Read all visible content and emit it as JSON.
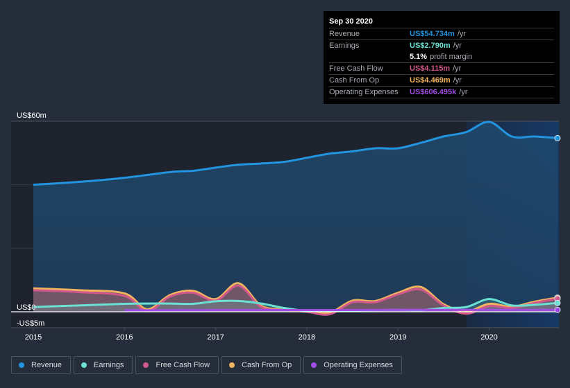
{
  "tooltip": {
    "date": "Sep 30 2020",
    "rows": [
      {
        "label": "Revenue",
        "value": "US$54.734m",
        "unit": "/yr",
        "color": "#2394df"
      },
      {
        "label": "Earnings",
        "value": "US$2.790m",
        "unit": "/yr",
        "color": "#6ce0d3"
      },
      {
        "label": "",
        "margin_pct": "5.1%",
        "margin_text": "profit margin"
      },
      {
        "label": "Free Cash Flow",
        "value": "US$4.115m",
        "unit": "/yr",
        "color": "#d1588b"
      },
      {
        "label": "Cash From Op",
        "value": "US$4.469m",
        "unit": "/yr",
        "color": "#f2b35e"
      },
      {
        "label": "Operating Expenses",
        "value": "US$606.495k",
        "unit": "/yr",
        "color": "#a24de8"
      }
    ]
  },
  "legend": [
    {
      "label": "Revenue",
      "color": "#2394df"
    },
    {
      "label": "Earnings",
      "color": "#6ce0d3"
    },
    {
      "label": "Free Cash Flow",
      "color": "#d1588b"
    },
    {
      "label": "Cash From Op",
      "color": "#f2b35e"
    },
    {
      "label": "Operating Expenses",
      "color": "#a24de8"
    }
  ],
  "chart_data": {
    "type": "area",
    "title": "",
    "xlabel": "",
    "ylabel": "",
    "xlim": [
      2015.0,
      2020.75
    ],
    "ylim": [
      -5,
      60
    ],
    "y_ticks": [
      {
        "value": 60,
        "label": "US$60m"
      },
      {
        "value": 0,
        "label": "US$0"
      },
      {
        "value": -5,
        "label": "-US$5m"
      }
    ],
    "x_ticks": [
      {
        "value": 2015,
        "label": "2015"
      },
      {
        "value": 2016,
        "label": "2016"
      },
      {
        "value": 2017,
        "label": "2017"
      },
      {
        "value": 2018,
        "label": "2018"
      },
      {
        "value": 2019,
        "label": "2019"
      },
      {
        "value": 2020,
        "label": "2020"
      }
    ],
    "highlight_from": 2019.75,
    "grid": true,
    "legend_position": "bottom-left",
    "series": [
      {
        "name": "Revenue",
        "color": "#2394df",
        "x": [
          2015.0,
          2015.5,
          2016.0,
          2016.5,
          2016.75,
          2017.0,
          2017.25,
          2017.5,
          2017.75,
          2018.0,
          2018.25,
          2018.5,
          2018.75,
          2019.0,
          2019.25,
          2019.5,
          2019.75,
          2020.0,
          2020.25,
          2020.5,
          2020.75
        ],
        "values": [
          40.0,
          40.9,
          42.2,
          44.0,
          44.4,
          45.4,
          46.3,
          46.7,
          47.2,
          48.5,
          49.8,
          50.5,
          51.5,
          51.5,
          53.2,
          55.2,
          56.6,
          59.8,
          55.2,
          55.2,
          54.7
        ]
      },
      {
        "name": "Earnings",
        "color": "#6ce0d3",
        "x": [
          2015.0,
          2015.5,
          2016.0,
          2016.25,
          2016.5,
          2016.75,
          2017.0,
          2017.25,
          2017.5,
          2017.75,
          2018.0,
          2018.25,
          2018.5,
          2018.75,
          2019.0,
          2019.25,
          2019.5,
          2019.75,
          2020.0,
          2020.25,
          2020.5,
          2020.75
        ],
        "values": [
          1.5,
          2.0,
          2.5,
          2.6,
          2.6,
          2.5,
          3.3,
          3.4,
          2.6,
          1.2,
          0.3,
          0.3,
          0.4,
          0.5,
          0.6,
          0.5,
          1.2,
          1.5,
          4.0,
          2.0,
          2.2,
          2.79
        ]
      },
      {
        "name": "Free Cash Flow",
        "color": "#d1588b",
        "x": [
          2015.0,
          2015.5,
          2016.0,
          2016.25,
          2016.5,
          2016.75,
          2017.0,
          2017.25,
          2017.5,
          2017.75,
          2018.0,
          2018.25,
          2018.5,
          2018.75,
          2019.0,
          2019.25,
          2019.5,
          2019.75,
          2020.0,
          2020.25,
          2020.5,
          2020.75
        ],
        "values": [
          6.8,
          6.2,
          5.0,
          0.2,
          4.8,
          6.0,
          3.5,
          8.2,
          1.5,
          0.6,
          0.0,
          -0.8,
          3.0,
          3.0,
          5.5,
          7.0,
          2.0,
          -0.6,
          1.8,
          1.2,
          2.8,
          4.115
        ]
      },
      {
        "name": "Cash From Op",
        "color": "#f2b35e",
        "x": [
          2015.0,
          2015.5,
          2016.0,
          2016.25,
          2016.5,
          2016.75,
          2017.0,
          2017.25,
          2017.5,
          2017.75,
          2018.0,
          2018.25,
          2018.5,
          2018.75,
          2019.0,
          2019.25,
          2019.5,
          2019.75,
          2020.0,
          2020.25,
          2020.5,
          2020.75
        ],
        "values": [
          7.4,
          6.8,
          5.8,
          0.8,
          5.3,
          6.6,
          4.0,
          9.0,
          1.9,
          0.8,
          0.2,
          -0.3,
          3.5,
          3.4,
          6.0,
          7.8,
          2.4,
          0.1,
          2.5,
          1.6,
          3.2,
          4.469
        ]
      },
      {
        "name": "Operating Expenses",
        "color": "#a24de8",
        "x": [
          2016.0,
          2016.5,
          2017.0,
          2017.5,
          2018.0,
          2018.5,
          2019.0,
          2019.5,
          2020.0,
          2020.5,
          2020.75
        ],
        "values": [
          0.5,
          0.5,
          0.55,
          0.55,
          0.55,
          0.55,
          0.6,
          0.6,
          0.6,
          0.6,
          0.606
        ]
      }
    ]
  }
}
